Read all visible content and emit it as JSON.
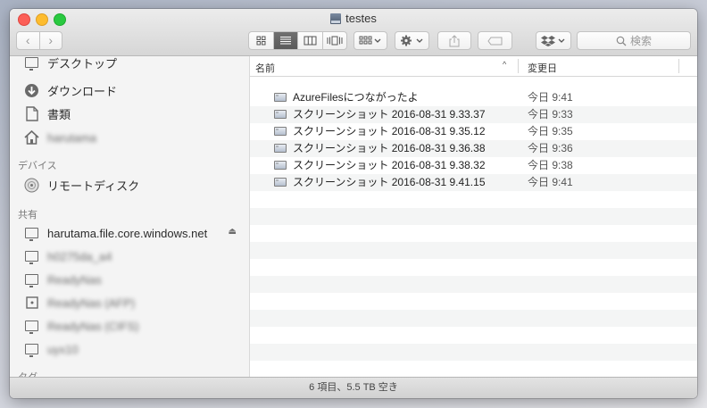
{
  "window": {
    "title": "testes"
  },
  "toolbar": {
    "back_glyph": "‹",
    "forward_glyph": "›",
    "search_placeholder": "検索",
    "icons": [
      "icon-view-icon",
      "list-view-icon",
      "column-view-icon",
      "cover-flow-icon",
      "arrange-icon",
      "gear-icon",
      "share-icon",
      "tag-icon",
      "dropbox-icon",
      "search-icon"
    ]
  },
  "sidebar": {
    "items_top": [
      {
        "label": "デスクトップ",
        "icon": "desktop-icon"
      },
      {
        "label": "ダウンロード",
        "icon": "download-icon"
      },
      {
        "label": "書類",
        "icon": "documents-icon"
      },
      {
        "label": "harutama",
        "icon": "home-icon"
      }
    ],
    "devices_heading": "デバイス",
    "devices": [
      {
        "label": "リモートディスク",
        "icon": "disc-icon"
      }
    ],
    "shared_heading": "共有",
    "shared": [
      {
        "label": "harutama.file.core.windows.net",
        "icon": "monitor-icon"
      },
      {
        "label": "h0275da_a4",
        "icon": "monitor-icon"
      },
      {
        "label": "ReadyNas",
        "icon": "monitor-icon"
      },
      {
        "label": "ReadyNas (AFP)",
        "icon": "server-icon"
      },
      {
        "label": "ReadyNas (CIFS)",
        "icon": "monitor-icon"
      },
      {
        "label": "uyx10",
        "icon": "monitor-icon"
      }
    ],
    "tags_heading": "タグ"
  },
  "columns": {
    "name": "名前",
    "date": "変更日"
  },
  "files": [
    {
      "name": "AzureFilesにつながったよ",
      "date": "今日 9:41"
    },
    {
      "name": "スクリーンショット 2016-08-31 9.33.37",
      "date": "今日 9:33"
    },
    {
      "name": "スクリーンショット 2016-08-31 9.35.12",
      "date": "今日 9:35"
    },
    {
      "name": "スクリーンショット 2016-08-31 9.36.38",
      "date": "今日 9:36"
    },
    {
      "name": "スクリーンショット 2016-08-31 9.38.32",
      "date": "今日 9:38"
    },
    {
      "name": "スクリーンショット 2016-08-31 9.41.15",
      "date": "今日 9:41"
    }
  ],
  "status": {
    "text": "6 項目、5.5 TB 空き"
  }
}
